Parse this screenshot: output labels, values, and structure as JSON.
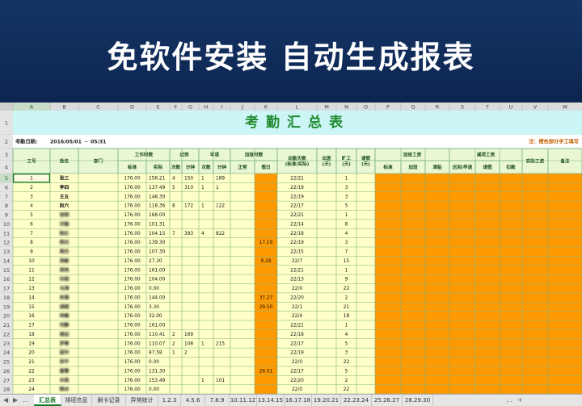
{
  "banner": {
    "text": "免软件安装 自动生成报表"
  },
  "spreadsheet": {
    "columns": [
      "A",
      "B",
      "C",
      "D",
      "E",
      "F",
      "G",
      "H",
      "I",
      "J",
      "K",
      "L",
      "M",
      "N",
      "O",
      "P",
      "Q",
      "R",
      "S",
      "T",
      "U",
      "V",
      "W"
    ],
    "rows": [
      "1",
      "2",
      "3",
      "4",
      "5",
      "6",
      "7",
      "8",
      "9",
      "10",
      "11",
      "12",
      "13",
      "14",
      "15",
      "16",
      "17",
      "18",
      "19",
      "20",
      "21",
      "22",
      "23",
      "24",
      "25",
      "26",
      "27",
      "28"
    ],
    "title": "考勤汇总表",
    "date_label": "考勤日期:",
    "date_start": "2016/05/01",
    "date_sep": "~",
    "date_end": "05/31",
    "note": "注：橙色部分手工填写",
    "headers": {
      "emp_no": "工号",
      "name": "姓名",
      "dept": "部门",
      "work_hours": "工作时数",
      "late": "迟到",
      "early": "早退",
      "ot_hours": "加班时数",
      "attend_days": "出勤天数\n(标准/实际)",
      "biz_days": "出差\n(天)",
      "absent": "旷工\n(天)",
      "leave": "请假\n(天)",
      "ot_pay": "加班工资",
      "deduct": "减项工资",
      "actual_pay": "实际工资",
      "remark": "备注",
      "std": "标准",
      "act": "实际",
      "late_cnt": "次数",
      "late_min": "分钟",
      "early_cnt": "次数",
      "early_min": "分钟",
      "normal": "正常",
      "holiday": "假日",
      "ot_std": "标准",
      "ot_add": "加班",
      "ot_sub": "津贴",
      "d_late": "迟到/早退",
      "d_leave": "请假",
      "d_fine": "扣款"
    },
    "records": [
      {
        "no": "1",
        "name": "张三",
        "std": "176.00",
        "act": "156.21",
        "lc": "4",
        "lm": "150",
        "ec": "1",
        "em": "189",
        "hol": "",
        "att": "22/21",
        "abs": "1",
        "blur": false
      },
      {
        "no": "2",
        "name": "李四",
        "std": "176.00",
        "act": "137.49",
        "lc": "5",
        "lm": "310",
        "ec": "1",
        "em": "1",
        "hol": "",
        "att": "22/19",
        "abs": "3",
        "blur": false
      },
      {
        "no": "3",
        "name": "王五",
        "std": "176.00",
        "act": "148.30",
        "lc": "",
        "lm": "",
        "ec": "",
        "em": "",
        "hol": "",
        "att": "22/19",
        "abs": "3",
        "blur": false
      },
      {
        "no": "4",
        "name": "赵六",
        "std": "176.00",
        "act": "118.36",
        "lc": "8",
        "lm": "172",
        "ec": "1",
        "em": "122",
        "hol": "",
        "att": "22/17",
        "abs": "5",
        "blur": false
      },
      {
        "no": "5",
        "name": "张明",
        "std": "176.00",
        "act": "168.00",
        "lc": "",
        "lm": "",
        "ec": "",
        "em": "",
        "hol": "",
        "att": "22/21",
        "abs": "1",
        "blur": true
      },
      {
        "no": "6",
        "name": "刘强",
        "std": "176.00",
        "act": "101.31",
        "lc": "",
        "lm": "",
        "ec": "",
        "em": "",
        "hol": "",
        "att": "22/14",
        "abs": "8",
        "blur": true
      },
      {
        "no": "7",
        "name": "陈红",
        "std": "176.00",
        "act": "104.15",
        "lc": "7",
        "lm": "393",
        "ec": "4",
        "em": "822",
        "hol": "",
        "att": "22/18",
        "abs": "4",
        "blur": true
      },
      {
        "no": "8",
        "name": "杨光",
        "std": "176.00",
        "act": "139.30",
        "lc": "",
        "lm": "",
        "ec": "",
        "em": "",
        "hol": "17.19",
        "att": "22/19",
        "abs": "3",
        "blur": true
      },
      {
        "no": "9",
        "name": "周杰",
        "std": "176.00",
        "act": "107.30",
        "lc": "",
        "lm": "",
        "ec": "",
        "em": "",
        "hol": "",
        "att": "22/15",
        "abs": "7",
        "blur": true
      },
      {
        "no": "10",
        "name": "吴敏",
        "std": "176.00",
        "act": "27.30",
        "lc": "",
        "lm": "",
        "ec": "",
        "em": "",
        "hol": "9.28",
        "att": "22/7",
        "abs": "15",
        "blur": true
      },
      {
        "no": "11",
        "name": "郑伟",
        "std": "176.00",
        "act": "161.00",
        "lc": "",
        "lm": "",
        "ec": "",
        "em": "",
        "hol": "",
        "att": "22/21",
        "abs": "1",
        "blur": true
      },
      {
        "no": "12",
        "name": "孙丽",
        "std": "176.00",
        "act": "104.00",
        "lc": "",
        "lm": "",
        "ec": "",
        "em": "",
        "hol": "",
        "att": "22/13",
        "abs": "9",
        "blur": true
      },
      {
        "no": "13",
        "name": "马涛",
        "std": "176.00",
        "act": "0.00",
        "lc": "",
        "lm": "",
        "ec": "",
        "em": "",
        "hol": "",
        "att": "22/0",
        "abs": "22",
        "blur": true
      },
      {
        "no": "14",
        "name": "朱琳",
        "std": "176.00",
        "act": "144.00",
        "lc": "",
        "lm": "",
        "ec": "",
        "em": "",
        "hol": "37.27",
        "att": "22/20",
        "abs": "2",
        "blur": true
      },
      {
        "no": "15",
        "name": "胡斌",
        "std": "176.00",
        "act": "3.30",
        "lc": "",
        "lm": "",
        "ec": "",
        "em": "",
        "hol": "29.50",
        "att": "22/1",
        "abs": "21",
        "blur": true
      },
      {
        "no": "16",
        "name": "林峰",
        "std": "176.00",
        "act": "32.00",
        "lc": "",
        "lm": "",
        "ec": "",
        "em": "",
        "hol": "",
        "att": "22/4",
        "abs": "18",
        "blur": true
      },
      {
        "no": "17",
        "name": "何静",
        "std": "176.00",
        "act": "161.00",
        "lc": "",
        "lm": "",
        "ec": "",
        "em": "",
        "hol": "",
        "att": "22/21",
        "abs": "1",
        "blur": true
      },
      {
        "no": "18",
        "name": "高远",
        "std": "176.00",
        "act": "110.41",
        "lc": "2",
        "lm": "169",
        "ec": "",
        "em": "",
        "hol": "",
        "att": "22/18",
        "abs": "4",
        "blur": true
      },
      {
        "no": "19",
        "name": "罗青",
        "std": "176.00",
        "act": "110.07",
        "lc": "2",
        "lm": "108",
        "ec": "1",
        "em": "215",
        "hol": "",
        "att": "22/17",
        "abs": "5",
        "blur": true
      },
      {
        "no": "20",
        "name": "梁华",
        "std": "176.00",
        "act": "87.58",
        "lc": "1",
        "lm": "2",
        "ec": "",
        "em": "",
        "hol": "",
        "att": "22/19",
        "abs": "3",
        "blur": true
      },
      {
        "no": "21",
        "name": "宋平",
        "std": "176.00",
        "act": "0.00",
        "lc": "",
        "lm": "",
        "ec": "",
        "em": "",
        "hol": "",
        "att": "22/0",
        "abs": "22",
        "blur": true
      },
      {
        "no": "22",
        "name": "唐雪",
        "std": "176.00",
        "act": "131.30",
        "lc": "",
        "lm": "",
        "ec": "",
        "em": "",
        "hol": "26.01",
        "att": "22/17",
        "abs": "5",
        "blur": true
      },
      {
        "no": "23",
        "name": "许亮",
        "std": "176.00",
        "act": "153.49",
        "lc": "",
        "lm": "",
        "ec": "1",
        "em": "101",
        "hol": "",
        "att": "22/20",
        "abs": "2",
        "blur": true
      },
      {
        "no": "24",
        "name": "韩冰",
        "std": "176.00",
        "act": "0.00",
        "lc": "",
        "lm": "",
        "ec": "",
        "em": "",
        "hol": "",
        "att": "22/0",
        "abs": "22",
        "blur": true
      }
    ]
  },
  "tabs": [
    "汇总表",
    "排班信息",
    "刷卡记录",
    "异常统计",
    "1.2.3",
    "4.5.6",
    "7.8.9",
    "10.11.12",
    "13.14.15",
    "16.17.18",
    "19.20.21",
    "22.23.24",
    "25.26.27",
    "28.29.30"
  ],
  "tab_controls": {
    "prev": "◀",
    "next": "▶",
    "more": "...",
    "add": "+"
  },
  "colors": {
    "banner": "#0f2a5a",
    "title_fill": "#ccf5f5",
    "title_text": "#1f8a2e",
    "header_fill": "#e9f7d4",
    "row_fill": "#ffffc8",
    "input_fill": "#ff9900",
    "note": "#c06000",
    "grid": "#7fb37f"
  }
}
